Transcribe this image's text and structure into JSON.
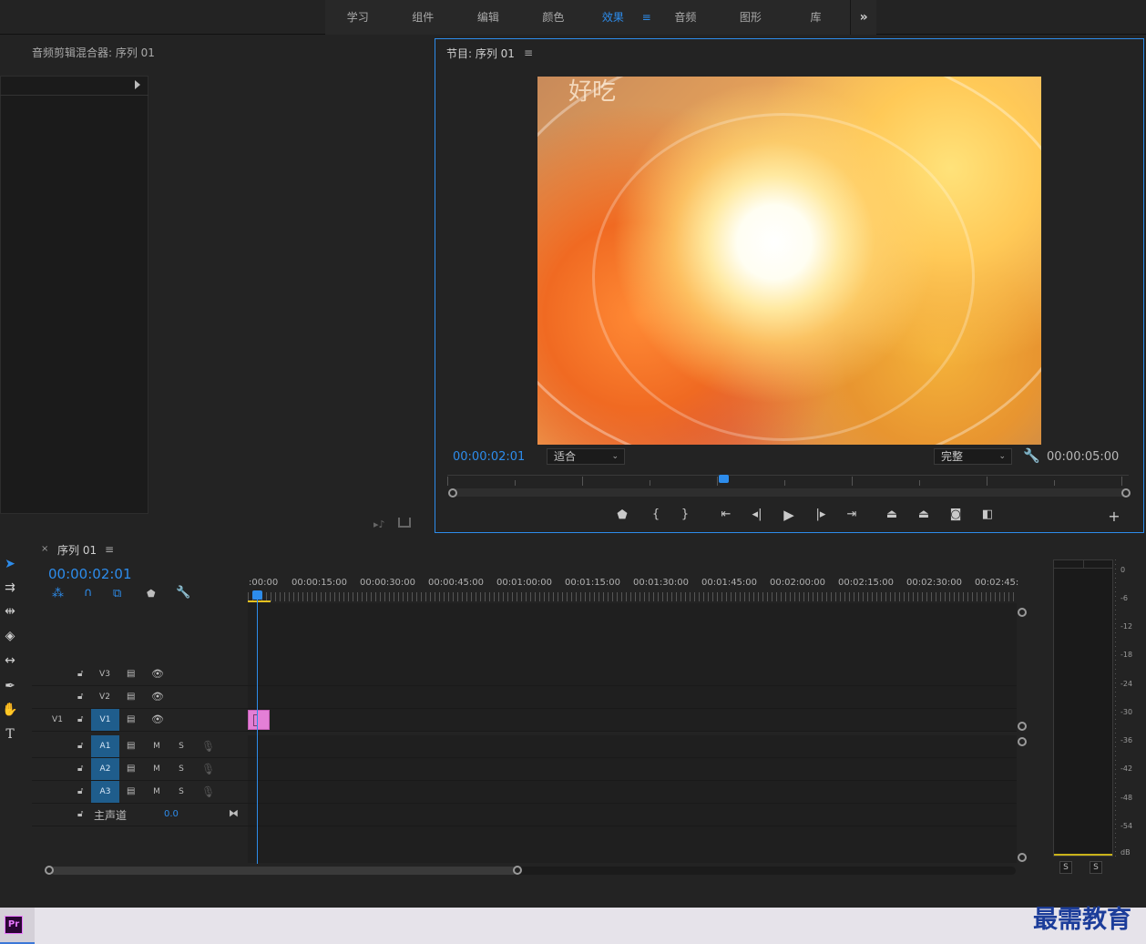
{
  "workspace_tabs": [
    {
      "label": "学习",
      "active": false
    },
    {
      "label": "组件",
      "active": false
    },
    {
      "label": "编辑",
      "active": false
    },
    {
      "label": "颜色",
      "active": false
    },
    {
      "label": "效果",
      "active": true
    },
    {
      "label": "音频",
      "active": false
    },
    {
      "label": "图形",
      "active": false
    },
    {
      "label": "库",
      "active": false
    }
  ],
  "workspace_more": "»",
  "workspace_menu_icon": "≡",
  "mixer": {
    "title": "音频剪辑混合器: 序列 01"
  },
  "program": {
    "title": "节目: 序列 01",
    "menu_icon": "≡",
    "video_caption": "好吃",
    "current_timecode": "00:00:02:01",
    "fit_select": "适合",
    "quality_select": "完整",
    "duration": "00:00:05:00",
    "playhead_fraction": 0.41
  },
  "timeline": {
    "tab_close": "×",
    "title": "序列 01",
    "menu_icon": "≡",
    "timecode": "00:00:02:01",
    "ruler_labels": [
      ":00:00",
      "00:00:15:00",
      "00:00:30:00",
      "00:00:45:00",
      "00:01:00:00",
      "00:01:15:00",
      "00:01:30:00",
      "00:01:45:00",
      "00:02:00:00",
      "00:02:15:00",
      "00:02:30:00",
      "00:02:45:"
    ],
    "video_tracks": [
      {
        "name": "V3",
        "source": ""
      },
      {
        "name": "V2",
        "source": ""
      },
      {
        "name": "V1",
        "source": "V1"
      }
    ],
    "audio_tracks": [
      {
        "name": "A1",
        "mute": "M",
        "solo": "S"
      },
      {
        "name": "A2",
        "mute": "M",
        "solo": "S"
      },
      {
        "name": "A3",
        "mute": "M",
        "solo": "S"
      }
    ],
    "master": {
      "label": "主声道",
      "value": "0.0"
    },
    "clip_color": "#e37fd6"
  },
  "meter": {
    "scale": [
      "0",
      "-6",
      "-12",
      "-18",
      "-24",
      "-30",
      "-36",
      "-42",
      "-48",
      "-54",
      "dB"
    ],
    "solo_left": "S",
    "solo_right": "S"
  },
  "taskbar": {
    "app_icon": "Pr",
    "watermark": "最需教育"
  },
  "colors": {
    "accent": "#2d8ceb",
    "target_track": "#1f5d8c",
    "clip": "#e37fd6"
  }
}
